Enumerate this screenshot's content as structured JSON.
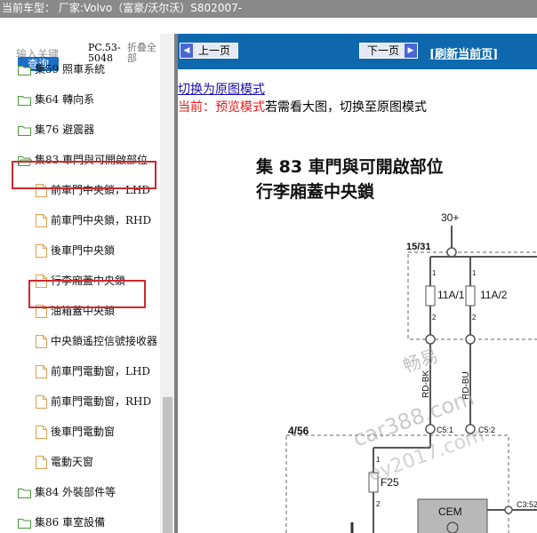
{
  "topbar": {
    "text": "当前车型： 厂家:Volvo（富豪/沃尔沃）S802007-"
  },
  "sidebar": {
    "search_placeholder": "输入关键",
    "query_label": "查询",
    "pc_code": "PC.53-5048",
    "collapse_all": "折叠全部",
    "items": [
      {
        "label": "集59 照車系統",
        "type": "folder"
      },
      {
        "label": "集64 轉向系",
        "type": "folder"
      },
      {
        "label": "集76 避震器",
        "type": "folder"
      },
      {
        "label": "集83 車門與可開啟部位",
        "type": "folder-open"
      },
      {
        "label": "前車門中央鎖，LHD",
        "type": "doc"
      },
      {
        "label": "前車門中央鎖，RHD",
        "type": "doc"
      },
      {
        "label": "後車門中央鎖",
        "type": "doc"
      },
      {
        "label": "行李廂蓋中央鎖",
        "type": "doc"
      },
      {
        "label": "油箱蓋中央鎖",
        "type": "doc"
      },
      {
        "label": "中央鎖遙控信號接收器",
        "type": "doc"
      },
      {
        "label": "前車門電動窗，LHD",
        "type": "doc"
      },
      {
        "label": "前車門電動窗，RHD",
        "type": "doc"
      },
      {
        "label": "後車門電動窗",
        "type": "doc"
      },
      {
        "label": "電動天窗",
        "type": "doc"
      },
      {
        "label": "集84 外裝部件等",
        "type": "folder"
      },
      {
        "label": "集86 車室設備",
        "type": "folder"
      }
    ]
  },
  "toolbar": {
    "prev_label": "上一页",
    "next_label": "下一页",
    "refresh_label": "[刷新当前页]"
  },
  "content": {
    "switch_link": "切换为原图模式",
    "mode_current": "当前：预览模式",
    "mode_hint": "若需看大图，切换至原图模式"
  },
  "diagram": {
    "title_line1": "集 83  車門與可開啟部位",
    "title_line2": "行李廂蓋中央鎖",
    "labels": {
      "v30": "30+",
      "zone1": "15/31",
      "fuse1": "11A/1",
      "fuse2": "11A/2",
      "pin1a": "1",
      "pin1b": "1",
      "pin2a": "2",
      "pin2b": "2",
      "wire1": "RD-BK",
      "wire2": "RD-BU",
      "zone2": "4/56",
      "conn1": "C5:1",
      "conn2": "C5:2",
      "fuse3": "F25",
      "pin1c": "1",
      "pin2c": "2",
      "cem": "CEM",
      "conn3": "C3:52"
    },
    "watermark1": "畅易",
    "watermark2": "car388.com",
    "watermark3": "ey2017.com"
  }
}
